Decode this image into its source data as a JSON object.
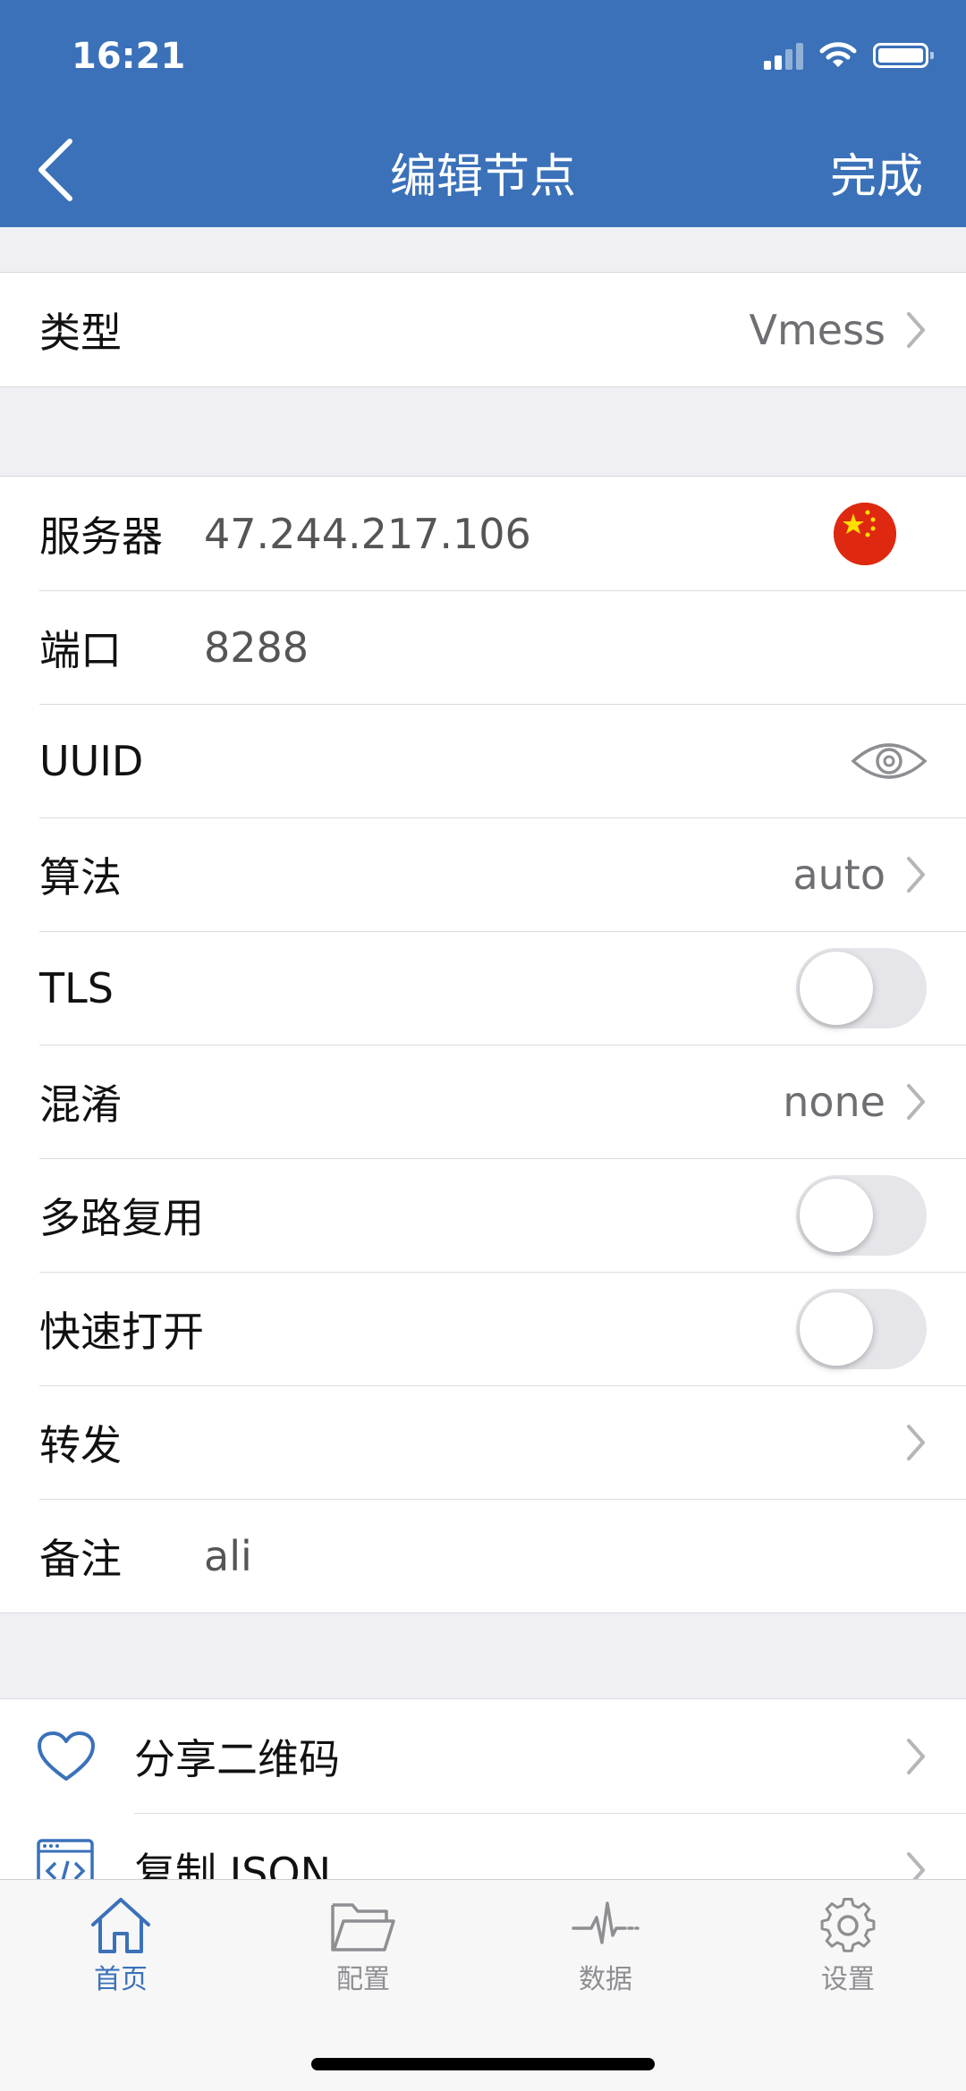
{
  "status_bar": {
    "time": "16:21"
  },
  "nav": {
    "title": "编辑节点",
    "done_label": "完成"
  },
  "type_section": {
    "label": "类型",
    "value": "Vmess"
  },
  "form": {
    "server": {
      "label": "服务器",
      "value": "47.244.217.106"
    },
    "port": {
      "label": "端口",
      "value": "8288"
    },
    "uuid": {
      "label": "UUID"
    },
    "algorithm": {
      "label": "算法",
      "value": "auto"
    },
    "tls": {
      "label": "TLS",
      "enabled": false
    },
    "obfs": {
      "label": "混淆",
      "value": "none"
    },
    "mux": {
      "label": "多路复用",
      "enabled": false
    },
    "fast_open": {
      "label": "快速打开",
      "enabled": false
    },
    "forward": {
      "label": "转发"
    },
    "remark": {
      "label": "备注",
      "value": "ali"
    }
  },
  "actions": {
    "share_qr": {
      "label": "分享二维码",
      "icon": "heart-icon"
    },
    "copy_json": {
      "label": "复制 JSON",
      "icon": "code-window-icon"
    }
  },
  "tabbar": {
    "active": "home",
    "tabs": [
      {
        "id": "home",
        "label": "首页",
        "icon": "home-icon"
      },
      {
        "id": "config",
        "label": "配置",
        "icon": "folder-icon"
      },
      {
        "id": "data",
        "label": "数据",
        "icon": "pulse-icon"
      },
      {
        "id": "settings",
        "label": "设置",
        "icon": "gear-icon"
      }
    ]
  },
  "colors": {
    "accent": "#3a71b9",
    "background": "#efeff4",
    "toggle_off": "#e5e5ea",
    "inactive_tab": "#8e8e93"
  }
}
